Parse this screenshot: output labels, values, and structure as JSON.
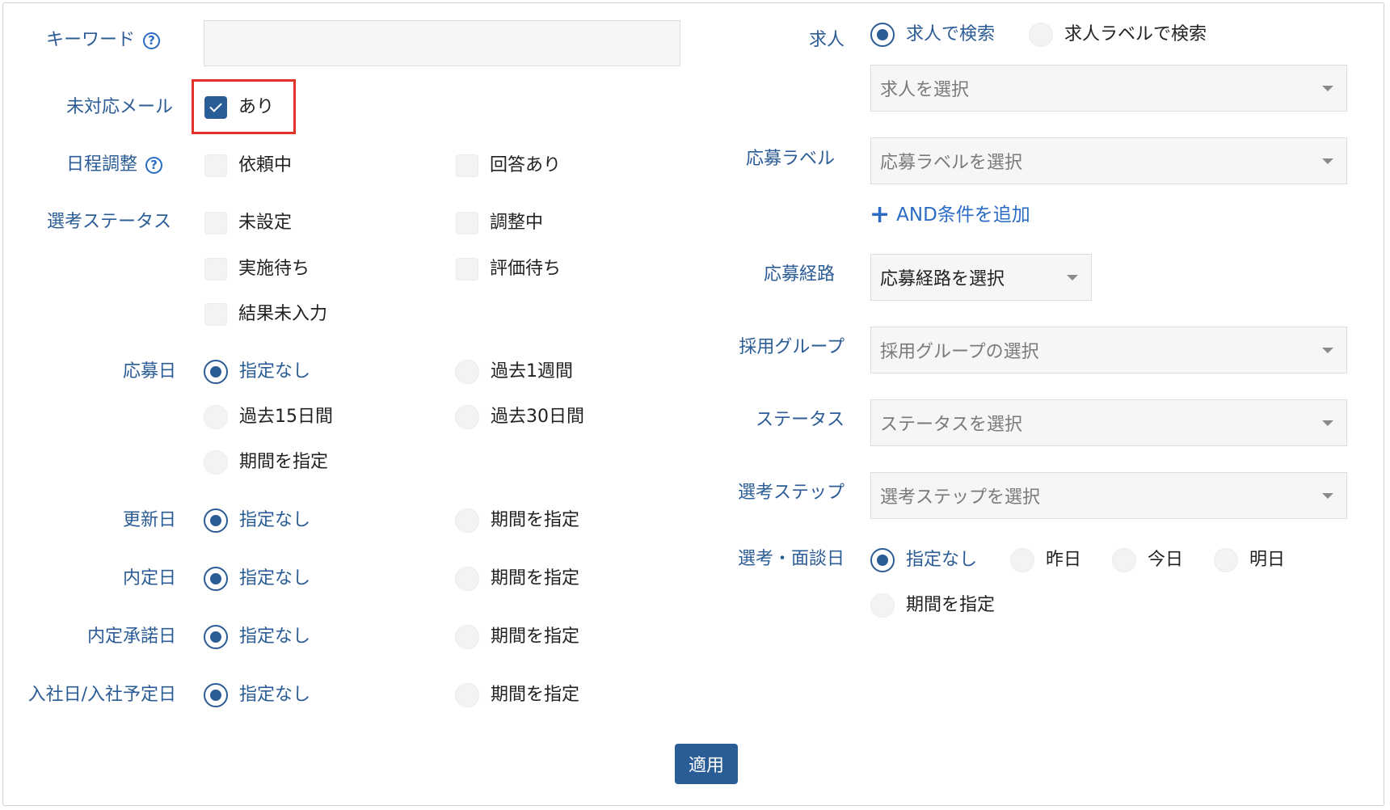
{
  "left": {
    "keyword_label": "キーワード",
    "unhandled_mail_label": "未対応メール",
    "unhandled_mail_option": "あり",
    "schedule_label": "日程調整",
    "schedule_options": [
      "依頼中",
      "回答あり"
    ],
    "selection_status_label": "選考ステータス",
    "selection_status_options": [
      "未設定",
      "調整中",
      "実施待ち",
      "評価待ち",
      "結果未入力"
    ],
    "apply_date_label": "応募日",
    "apply_date_options": [
      "指定なし",
      "過去1週間",
      "過去15日間",
      "過去30日間",
      "期間を指定"
    ],
    "updated_date_label": "更新日",
    "offer_date_label": "内定日",
    "offer_accept_date_label": "内定承諾日",
    "join_date_label": "入社日/入社予定日",
    "unspecified": "指定なし",
    "period_specify": "期間を指定"
  },
  "right": {
    "job_label": "求人",
    "job_search_options": [
      "求人で検索",
      "求人ラベルで検索"
    ],
    "job_select_placeholder": "求人を選択",
    "apply_label_label": "応募ラベル",
    "apply_label_placeholder": "応募ラベルを選択",
    "add_and_condition": "AND条件を追加",
    "apply_route_label": "応募経路",
    "apply_route_placeholder": "応募経路を選択",
    "hiring_group_label": "採用グループ",
    "hiring_group_placeholder": "採用グループの選択",
    "status_label": "ステータス",
    "status_placeholder": "ステータスを選択",
    "selection_step_label": "選考ステップ",
    "selection_step_placeholder": "選考ステップを選択",
    "interview_date_label": "選考・面談日",
    "interview_date_options": [
      "指定なし",
      "昨日",
      "今日",
      "明日",
      "期間を指定"
    ]
  },
  "apply_button": "適用",
  "colors": {
    "accent": "#2a5c95",
    "link": "#2b6cc4",
    "highlight": "#e2332a"
  }
}
